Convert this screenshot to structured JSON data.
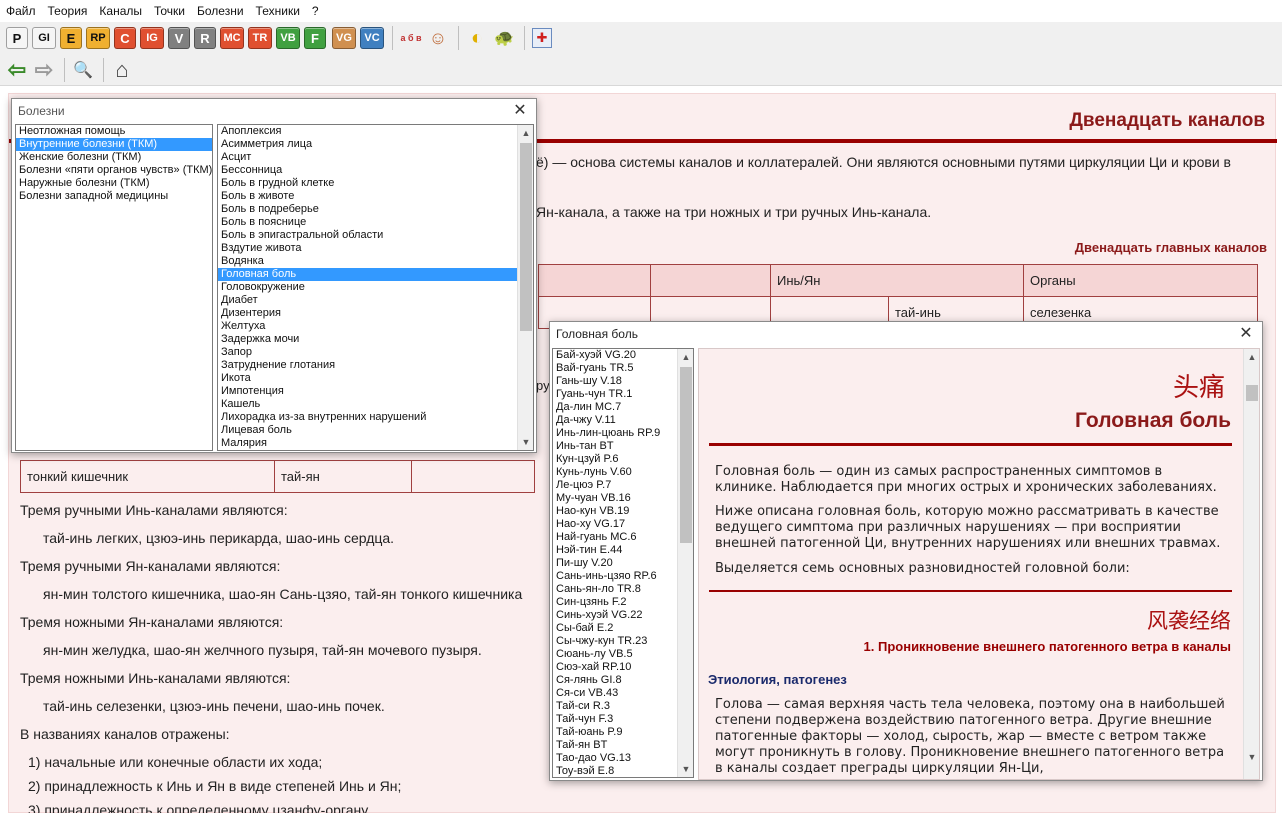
{
  "menu": [
    "Файл",
    "Теория",
    "Каналы",
    "Точки",
    "Болезни",
    "Техники",
    "?"
  ],
  "toolbar_buttons": [
    {
      "label": "P",
      "color": "#f5f5f5",
      "text_color": "#111"
    },
    {
      "label": "GI",
      "color": "#f5f5f5",
      "text_color": "#111"
    },
    {
      "label": "E",
      "color": "#f0b030",
      "text_color": "#111"
    },
    {
      "label": "RP",
      "color": "#f0b030",
      "text_color": "#111"
    },
    {
      "label": "C",
      "color": "#e05030",
      "text_color": "#fff"
    },
    {
      "label": "IG",
      "color": "#e05030",
      "text_color": "#fff"
    },
    {
      "label": "V",
      "color": "#808080",
      "text_color": "#fff"
    },
    {
      "label": "R",
      "color": "#808080",
      "text_color": "#fff"
    },
    {
      "label": "MC",
      "color": "#e05030",
      "text_color": "#fff"
    },
    {
      "label": "TR",
      "color": "#e05030",
      "text_color": "#fff"
    },
    {
      "label": "VB",
      "color": "#40a040",
      "text_color": "#fff"
    },
    {
      "label": "F",
      "color": "#40a040",
      "text_color": "#fff"
    },
    {
      "label": "VG",
      "color": "#d09050",
      "text_color": "#fff"
    },
    {
      "label": "VC",
      "color": "#4080c0",
      "text_color": "#fff"
    }
  ],
  "icons_row1": [
    "alphabet-icon",
    "face-icon",
    "yin-yang-icon",
    "turtle-icon",
    "medical-kit-icon"
  ],
  "icons_row1_glyphs": {
    "alphabet": "а б в",
    "face": "☺",
    "yinyang": "◐",
    "turtle": "🐢",
    "medkit": "✚"
  },
  "nav_glyphs": {
    "back": "⇦",
    "forward": "⇨",
    "search": "🔍",
    "home": "⌂"
  },
  "main": {
    "title": "Двенадцать каналов",
    "line1": "ё) — основа системы каналов и коллатералей. Они являются основными путями циркуляции Ци и крови в",
    "line2": "Ян-канала, а также на три ножных и три ручных Инь-канала.",
    "table_caption": "Двенадцать главных каналов",
    "table_header": {
      "col1": "Инь/Ян",
      "col2": "Органы"
    },
    "table_row1": {
      "yin_yang": "тай-инь",
      "organ": "селезенка"
    },
    "table_row_bottom": {
      "name": "тонкий кишечник",
      "yin_yang": "тай-ян"
    },
    "partial_text": "ру",
    "paragraphs": [
      "Тремя ручными Инь-каналами являются:",
      "тай-инь легких, цзюэ-инь перикарда, шао-инь сердца.",
      "Тремя ручными Ян-каналами являются:",
      "ян-мин толстого кишечника, шао-ян Сань-цзяо, тай-ян тонкого кишечника",
      "Тремя ножными Ян-каналами являются:",
      "ян-мин желудка, шао-ян желчного пузыря, тай-ян мочевого пузыря.",
      "Тремя ножными Инь-каналами являются:",
      "тай-инь селезенки, цзюэ-инь печени, шао-инь почек.",
      "В названиях каналов отражены:",
      "1) начальные или конечные области их хода;",
      "2) принадлежность к Инь и Ян в виде степеней Инь и Ян;",
      "3) принадлежность к определенному цзанфу-органу"
    ]
  },
  "diseases_dialog": {
    "title": "Болезни",
    "close": "✕",
    "categories": [
      "Неотложная помощь",
      "Внутренние болезни (ТКМ)",
      "Женские болезни (ТКМ)",
      "Болезни «пяти органов чувств» (ТКМ)",
      "Наружные болезни (ТКМ)",
      "Болезни западной медицины"
    ],
    "selected_category": 1,
    "items": [
      "Апоплексия",
      "Асимметрия лица",
      "Асцит",
      "Бессонница",
      "Боль в грудной клетке",
      "Боль в животе",
      "Боль в подреберье",
      "Боль в пояснице",
      "Боль в эпигастральной области",
      "Вздутие живота",
      "Водянка",
      "Головная боль",
      "Головокружение",
      "Диабет",
      "Дизентерия",
      "Желтуха",
      "Задержка мочи",
      "Запор",
      "Затруднение глотания",
      "Икота",
      "Импотенция",
      "Кашель",
      "Лихорадка из-за внутренних нарушений",
      "Лицевая боль",
      "Малярия"
    ],
    "selected_item": 11
  },
  "headache_dialog": {
    "title": "Головная боль",
    "close": "✕",
    "points": [
      "Бай-хуэй VG.20",
      "Вай-гуань TR.5",
      "Гань-шу V.18",
      "Гуань-чун TR.1",
      "Да-лин MC.7",
      "Да-чжу V.11",
      "Инь-лин-цюань RP.9",
      "Инь-тан BT",
      "Кун-цзуй P.6",
      "Кунь-лунь V.60",
      "Ле-цюэ P.7",
      "Му-чуан VB.16",
      "Нао-кун VB.19",
      "Нао-ху VG.17",
      "Най-гуань MC.6",
      "Нэй-тин E.44",
      "Пи-шу V.20",
      "Сань-инь-цзяо RP.6",
      "Сань-ян-ло TR.8",
      "Син-цзянь F.2",
      "Синь-хуэй VG.22",
      "Сы-бай E.2",
      "Сы-чжу-кун TR.23",
      "Сюань-лу VB.5",
      "Сюэ-хай RP.10",
      "Ся-лянь GI.8",
      "Ся-си VB.43",
      "Тай-си R.3",
      "Тай-чун F.3",
      "Тай-юань P.9",
      "Тай-ян BT",
      "Тао-дао VG.13",
      "Тоу-вэй E.8"
    ],
    "article": {
      "chinese_title": "头痛",
      "title": "Головная боль",
      "p1": "Головная боль — один из самых распространенных симптомов в клинике. Наблюдается при многих острых и хронических заболеваниях.",
      "p2": "Ниже описана головная боль, которую можно рассматривать в качестве ведущего симптома при различных нарушениях — при восприятии внешней патогенной Ци, внутренних нарушениях или внешних травмах.",
      "p3": "Выделяется семь основных разновидностей головной боли:",
      "chinese_subtitle": "风袭经络",
      "subtitle": "1. Проникновение внешнего патогенного ветра в каналы",
      "section": "Этиология, патогенез",
      "p4": "Голова — самая верхняя часть тела человека, поэтому она в наибольшей степени подвержена воздействию патогенного ветра. Другие внешние патогенные факторы — холод, сырость, жар — вместе с ветром также могут проникнуть в голову. Проникновение внешнего патогенного ветра в каналы создает преграды циркуляции Ян-Ци,"
    }
  }
}
